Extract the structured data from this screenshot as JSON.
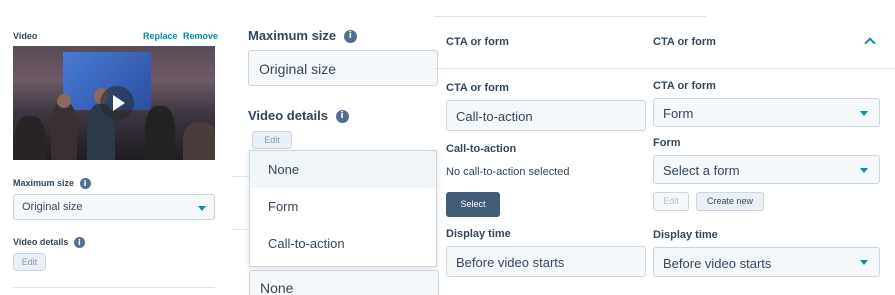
{
  "video_panel": {
    "video_label": "Video",
    "replace_link": "Replace",
    "remove_link": "Remove",
    "max_size_label": "Maximum size",
    "max_size_value": "Original size",
    "video_details_label": "Video details",
    "edit_button": "Edit"
  },
  "middle_panel": {
    "max_size_label": "Maximum size",
    "max_size_value": "Original size",
    "video_details_label": "Video details",
    "edit_button": "Edit",
    "dropdown_options": [
      "None",
      "Form",
      "Call-to-action"
    ],
    "bottom_value": "None"
  },
  "cta_panel": {
    "header": "CTA or form",
    "cta_or_form_label": "CTA or form",
    "cta_or_form_value": "Call-to-action",
    "call_to_action_label": "Call-to-action",
    "no_cta_text": "No call-to-action selected",
    "select_button": "Select",
    "display_time_label": "Display time",
    "display_time_value": "Before video starts"
  },
  "form_panel": {
    "header": "CTA or form",
    "cta_or_form_label": "CTA or form",
    "cta_or_form_value": "Form",
    "form_label": "Form",
    "form_placeholder": "Select a form",
    "edit_button": "Edit",
    "create_new_button": "Create new",
    "display_time_label": "Display time",
    "display_time_value": "Before video starts"
  },
  "colors": {
    "accent": "#0091ae",
    "text": "#33475b",
    "border": "#cbd6e2",
    "button_dark": "#425b76"
  }
}
